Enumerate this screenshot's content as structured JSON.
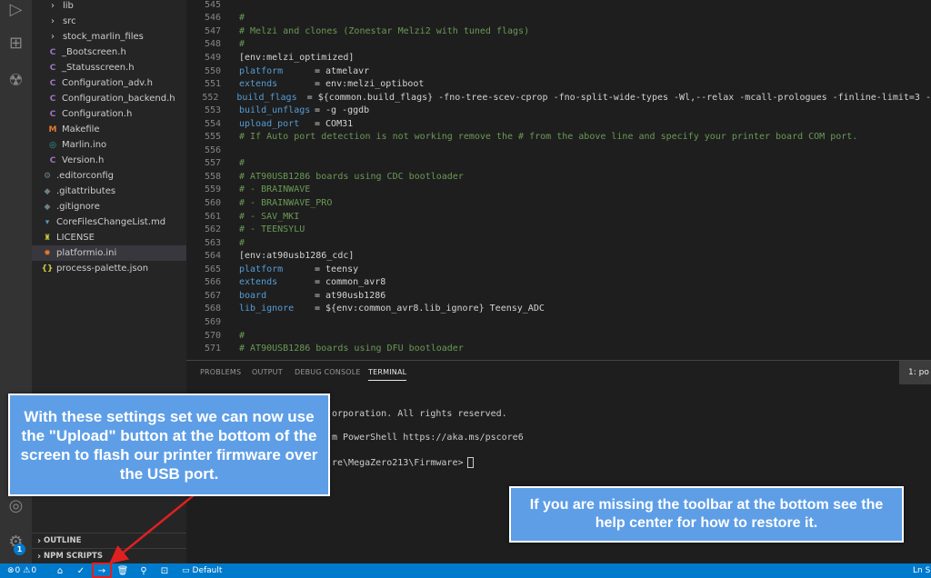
{
  "sidebar": {
    "items": [
      {
        "label": "lib",
        "type": "folder",
        "indent": 1
      },
      {
        "label": "src",
        "type": "folder",
        "indent": 1
      },
      {
        "label": "stock_marlin_files",
        "type": "folder",
        "indent": 1
      },
      {
        "label": "_Bootscreen.h",
        "type": "c",
        "indent": 2
      },
      {
        "label": "_Statusscreen.h",
        "type": "c",
        "indent": 2
      },
      {
        "label": "Configuration_adv.h",
        "type": "c",
        "indent": 2
      },
      {
        "label": "Configuration_backend.h",
        "type": "c",
        "indent": 2
      },
      {
        "label": "Configuration.h",
        "type": "c",
        "indent": 2
      },
      {
        "label": "Makefile",
        "type": "make",
        "indent": 2
      },
      {
        "label": "Marlin.ino",
        "type": "ino",
        "indent": 2
      },
      {
        "label": "Version.h",
        "type": "c",
        "indent": 2
      },
      {
        "label": ".editorconfig",
        "type": "gear",
        "indent": 0
      },
      {
        "label": ".gitattributes",
        "type": "git",
        "indent": 0
      },
      {
        "label": ".gitignore",
        "type": "git",
        "indent": 0
      },
      {
        "label": "CoreFilesChangeList.md",
        "type": "md",
        "indent": 0
      },
      {
        "label": "LICENSE",
        "type": "license",
        "indent": 0
      },
      {
        "label": "platformio.ini",
        "type": "pio",
        "indent": 0,
        "selected": true
      },
      {
        "label": "process-palette.json",
        "type": "json",
        "indent": 0
      }
    ],
    "outline_label": "OUTLINE",
    "npm_label": "NPM SCRIPTS"
  },
  "editor": {
    "lines": [
      {
        "n": "545",
        "t": ""
      },
      {
        "n": "546",
        "t": "#"
      },
      {
        "n": "547",
        "t": "# Melzi and clones (Zonestar Melzi2 with tuned flags)"
      },
      {
        "n": "548",
        "t": "#"
      },
      {
        "n": "549",
        "t": "[env:melzi_optimized]"
      },
      {
        "n": "550",
        "k": "platform",
        "v": "= atmelavr"
      },
      {
        "n": "551",
        "k": "extends",
        "v": "= env:melzi_optiboot"
      },
      {
        "n": "552",
        "k": "build_flags",
        "v": "= ${common.build_flags} -fno-tree-scev-cprop -fno-split-wide-types -Wl,--relax -mcall-prologues -finline-limit=3 -"
      },
      {
        "n": "553",
        "k": "build_unflags",
        "v": "= -g -ggdb"
      },
      {
        "n": "554",
        "k": "upload_port",
        "v": "= COM31"
      },
      {
        "n": "555",
        "t": "# If Auto port detection is not working remove the # from the above line and specify your printer board COM port."
      },
      {
        "n": "556",
        "t": ""
      },
      {
        "n": "557",
        "t": "#"
      },
      {
        "n": "558",
        "t": "# AT90USB1286 boards using CDC bootloader"
      },
      {
        "n": "559",
        "t": "# - BRAINWAVE"
      },
      {
        "n": "560",
        "t": "# - BRAINWAVE_PRO"
      },
      {
        "n": "561",
        "t": "# - SAV_MKI"
      },
      {
        "n": "562",
        "t": "# - TEENSYLU"
      },
      {
        "n": "563",
        "t": "#"
      },
      {
        "n": "564",
        "t": "[env:at90usb1286_cdc]"
      },
      {
        "n": "565",
        "k": "platform",
        "v": "= teensy"
      },
      {
        "n": "566",
        "k": "extends",
        "v": "= common_avr8"
      },
      {
        "n": "567",
        "k": "board",
        "v": "= at90usb1286"
      },
      {
        "n": "568",
        "k": "lib_ignore",
        "v": "= ${env:common_avr8.lib_ignore} Teensy_ADC"
      },
      {
        "n": "569",
        "t": ""
      },
      {
        "n": "570",
        "t": "#"
      },
      {
        "n": "571",
        "t": "# AT90USB1286 boards using DFU bootloader"
      }
    ]
  },
  "panel": {
    "tabs": [
      "PROBLEMS",
      "OUTPUT",
      "DEBUG CONSOLE",
      "TERMINAL"
    ],
    "terminal_select": "1: po",
    "terminal_lines": [
      "orporation. All rights reserved.",
      "m PowerShell https://aka.ms/pscore6",
      "re\\MegaZero213\\Firmware>"
    ]
  },
  "status_bar": {
    "errors": "0",
    "warnings": "0",
    "default_label": "Default",
    "position": "Ln S"
  },
  "activity": {
    "badge_count": "1"
  },
  "callouts": {
    "left": "With these settings set we can now use the \"Upload\" button at the bottom of the screen to flash our printer firmware over the USB port.",
    "right": "If you are missing the toolbar at the bottom see the help center for how to restore it."
  },
  "colors": {
    "accent": "#007acc",
    "callout": "#5e9ee6",
    "highlight": "#e02020"
  }
}
